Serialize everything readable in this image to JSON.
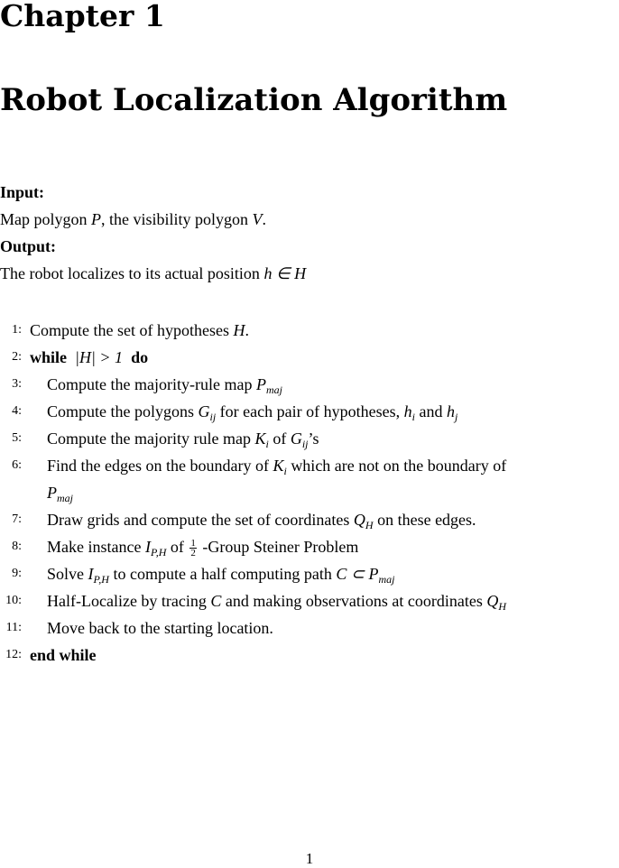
{
  "chapter": {
    "label": "Chapter 1",
    "title": "Robot Localization Algorithm"
  },
  "input": {
    "heading": "Input:",
    "text_1": "Map polygon ",
    "var_p": "P",
    "text_2": ", the visibility polygon ",
    "var_v": "V",
    "text_3": "."
  },
  "output": {
    "heading": "Output:",
    "text_1": "The robot localizes to its actual position ",
    "expr": "h ∈ H"
  },
  "lines": [
    {
      "num": "1:",
      "t1": "Compute the set of hypotheses ",
      "m1": "H",
      "t2": "."
    },
    {
      "num": "2:",
      "kw1": "while",
      "m1": "|H| > 1",
      "kw2": "do"
    },
    {
      "num": "3:",
      "t1": "Compute the majority-rule map ",
      "m1": "P",
      "s1": "maj"
    },
    {
      "num": "4:",
      "t1": "Compute the polygons ",
      "m1": "G",
      "s1": "ij",
      "t2": " for each pair of hypotheses, ",
      "m2": "h",
      "s2": "i",
      "t3": " and ",
      "m3": "h",
      "s3": "j"
    },
    {
      "num": "5:",
      "t1": "Compute the majority rule map ",
      "m1": "K",
      "s1": "i",
      "t2": " of ",
      "m2": "G",
      "s2": "ij",
      "t3": "’s"
    },
    {
      "num": "6:",
      "t1": "Find the edges on the boundary of ",
      "m1": "K",
      "s1": "i",
      "t2": " which are not on the boundary of",
      "m2": "P",
      "s2": "maj"
    },
    {
      "num": "7:",
      "t1": "Draw grids and compute the set of coordinates ",
      "m1": "Q",
      "s1": "H",
      "t2": " on these edges."
    },
    {
      "num": "8:",
      "t1": "Make instance ",
      "m1": "I",
      "s1": "P,H",
      "t2": " of ",
      "frac_num": "1",
      "frac_den": "2",
      "t3": " -Group Steiner Problem"
    },
    {
      "num": "9:",
      "t1": "Solve ",
      "m1": "I",
      "s1": "P,H",
      "t2": " to compute a half computing path ",
      "m2": "C ⊂ P",
      "s2": "maj"
    },
    {
      "num": "10:",
      "t1": "Half-Localize by tracing ",
      "m1": "C",
      "t2": " and making observations at coordinates ",
      "m2": "Q",
      "s2": "H"
    },
    {
      "num": "11:",
      "t1": "Move back to the starting location."
    },
    {
      "num": "12:",
      "kw1": "end while"
    }
  ],
  "page_number": "1"
}
